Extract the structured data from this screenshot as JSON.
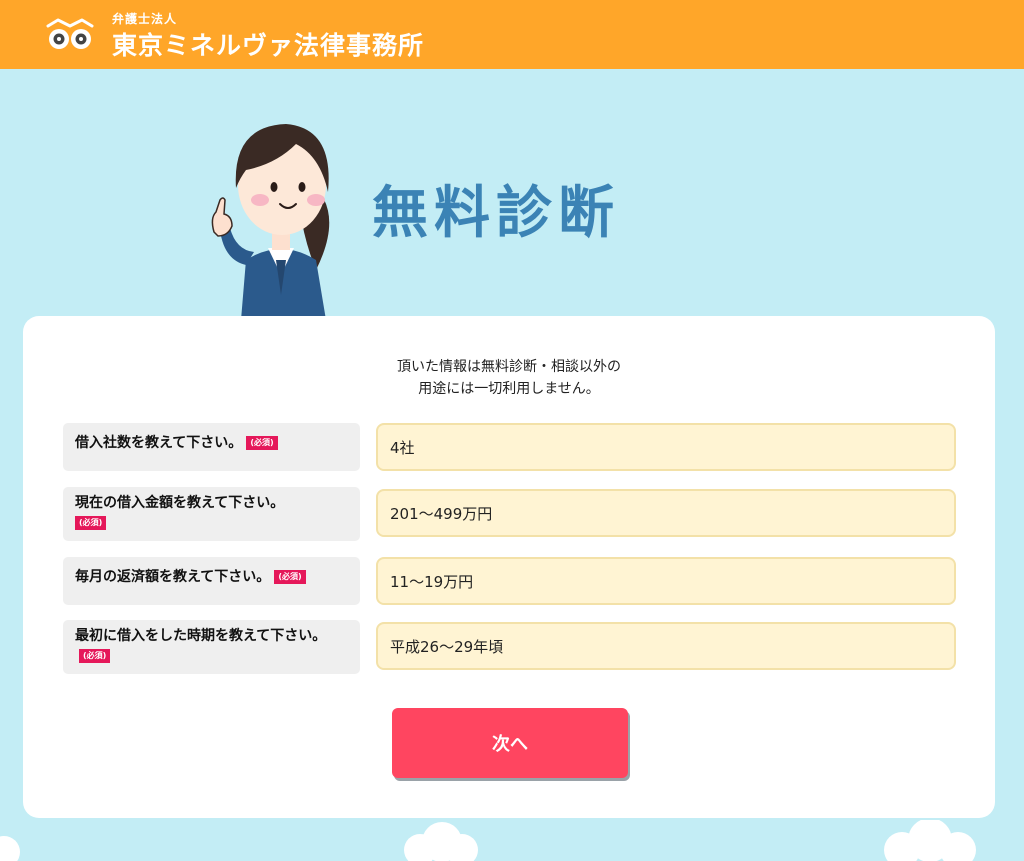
{
  "header": {
    "logo_small": "弁護士法人",
    "logo_main": "東京ミネルヴァ法律事務所",
    "logo_icon": "owl-eyes-icon"
  },
  "hero": {
    "title": "無料診断"
  },
  "form": {
    "notice_line1": "頂いた情報は無料診断・相談以外の",
    "notice_line2": "用途には一切利用しません。",
    "required_label": "(必須)",
    "fields": [
      {
        "label": "借入社数を教えて下さい。",
        "value": "4社"
      },
      {
        "label": "現在の借入金額を教えて下さい。",
        "value": "201～499万円"
      },
      {
        "label": "毎月の返済額を教えて下さい。",
        "value": "11～19万円"
      },
      {
        "label": "最初に借入をした時期を教えて下さい。",
        "value": "平成26～29年頃"
      }
    ],
    "next_button": "次へ"
  },
  "colors": {
    "header": "#ffa629",
    "background": "#c3edf5",
    "title": "#3b83b5",
    "required_badge": "#e5185a",
    "field_bg": "#fff4d3",
    "next_button": "#ff4560"
  }
}
